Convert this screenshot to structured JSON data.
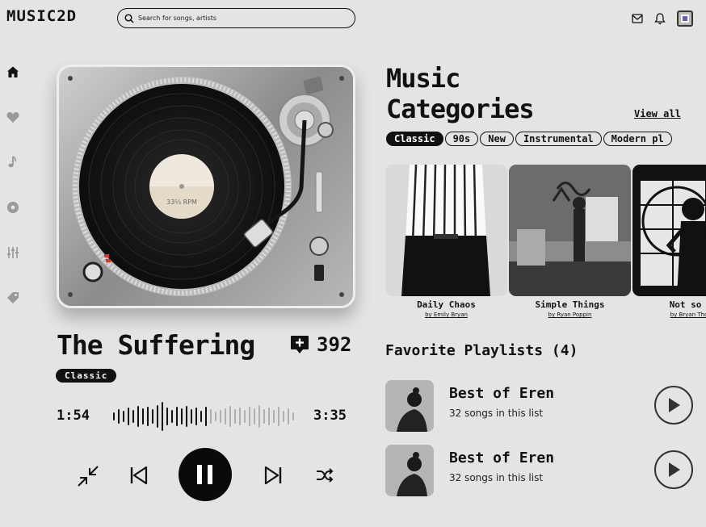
{
  "app": {
    "logo": "MUSIC2D"
  },
  "search": {
    "placeholder": "Search for songs, artists"
  },
  "header": {
    "icons": [
      "mail-icon",
      "bell-icon",
      "user-avatar"
    ]
  },
  "sidebar": {
    "items": [
      "home-icon",
      "heart-icon",
      "music-note-icon",
      "disc-icon",
      "equalizer-icon",
      "tag-icon"
    ]
  },
  "player": {
    "record_label": "33⅓ RPM",
    "title": "The Suffering",
    "likes": "392",
    "genre": "Classic",
    "elapsed": "1:54",
    "duration": "3:35",
    "progress": 0.53
  },
  "categories": {
    "title_line1": "Music",
    "title_line2": "Categories",
    "view_all": "View all",
    "chips": [
      "Classic",
      "90s",
      "New",
      "Instrumental",
      "Modern pl"
    ],
    "cards": [
      {
        "title": "Daily Chaos",
        "by": "by Emily Bryan"
      },
      {
        "title": "Simple Things",
        "by": "by Ryan Poppin"
      },
      {
        "title": "Not so go",
        "by": "by Bryan Thoma"
      }
    ]
  },
  "favorites": {
    "title": "Favorite Playlists (4)",
    "items": [
      {
        "name": "Best of Eren",
        "count": "32 songs in this list"
      },
      {
        "name": "Best of Eren",
        "count": "32 songs in this list"
      }
    ]
  },
  "colors": {
    "background": "#e4e4e4",
    "ink": "#111111",
    "accent": "#ffffff"
  }
}
